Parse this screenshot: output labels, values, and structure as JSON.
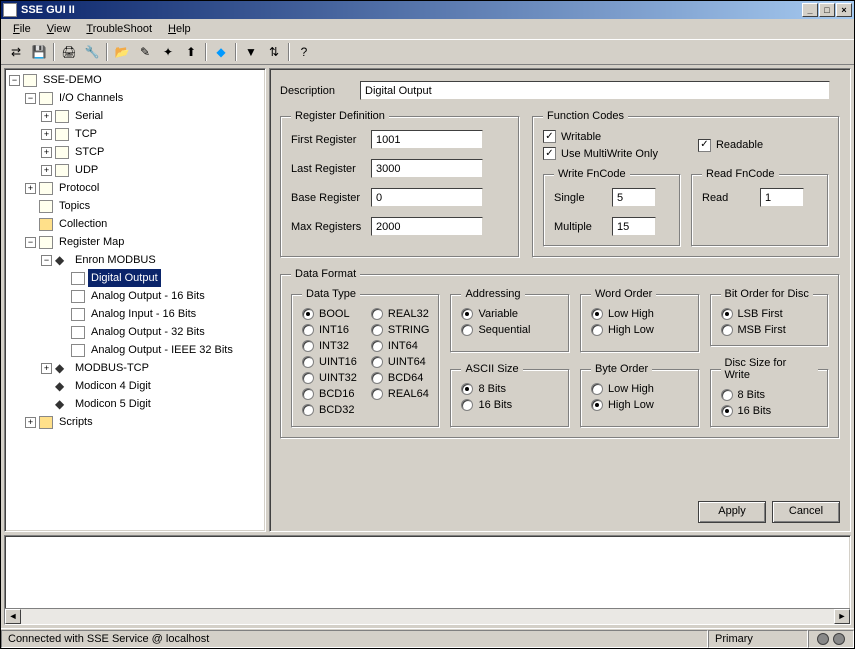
{
  "window": {
    "title": "SSE GUI II"
  },
  "menus": {
    "file": "File",
    "view": "View",
    "troubleshoot": "TroubleShoot",
    "help": "Help"
  },
  "tree": {
    "root": "SSE-DEMO",
    "io_channels": "I/O Channels",
    "serial": "Serial",
    "tcp": "TCP",
    "stcp": "STCP",
    "udp": "UDP",
    "protocol": "Protocol",
    "topics": "Topics",
    "collection": "Collection",
    "register_map": "Register Map",
    "enron": "Enron MODBUS",
    "digital_output": "Digital Output",
    "ao16": "Analog Output - 16 Bits",
    "ai16": "Analog Input - 16 Bits",
    "ao32": "Analog Output - 32 Bits",
    "aoieee": "Analog Output - IEEE 32 Bits",
    "modbus_tcp": "MODBUS-TCP",
    "mod4": "Modicon 4 Digit",
    "mod5": "Modicon 5 Digit",
    "scripts": "Scripts"
  },
  "form": {
    "description_lbl": "Description",
    "description_val": "Digital Output",
    "regdef_legend": "Register Definition",
    "first_reg_lbl": "First Register",
    "first_reg_val": "1001",
    "last_reg_lbl": "Last Register",
    "last_reg_val": "3000",
    "base_reg_lbl": "Base Register",
    "base_reg_val": "0",
    "max_reg_lbl": "Max Registers",
    "max_reg_val": "2000",
    "fncodes_legend": "Function Codes",
    "writable": "Writable",
    "readable": "Readable",
    "multiwrite": "Use MultiWrite Only",
    "write_fn_legend": "Write FnCode",
    "single": "Single",
    "single_val": "5",
    "multiple": "Multiple",
    "multiple_val": "15",
    "read_fn_legend": "Read FnCode",
    "read": "Read",
    "read_val": "1",
    "dataformat_legend": "Data Format",
    "datatype_legend": "Data Type",
    "dt": {
      "bool": "BOOL",
      "int16": "INT16",
      "int32": "INT32",
      "uint16": "UINT16",
      "uint32": "UINT32",
      "bcd16": "BCD16",
      "bcd32": "BCD32",
      "real32": "REAL32",
      "string": "STRING",
      "int64": "INT64",
      "uint64": "UINT64",
      "bcd64": "BCD64",
      "real64": "REAL64"
    },
    "addressing_legend": "Addressing",
    "variable": "Variable",
    "sequential": "Sequential",
    "ascii_legend": "ASCII Size",
    "bits8": "8 Bits",
    "bits16": "16 Bits",
    "wordorder_legend": "Word Order",
    "lowhigh": "Low High",
    "highlow": "High Low",
    "byteorder_legend": "Byte Order",
    "bitorder_legend": "Bit Order for Disc",
    "lsb": "LSB First",
    "msb": "MSB First",
    "discsize_legend": "Disc Size for Write",
    "apply": "Apply",
    "cancel": "Cancel"
  },
  "status": {
    "conn": "Connected with SSE Service @ localhost",
    "primary": "Primary"
  }
}
